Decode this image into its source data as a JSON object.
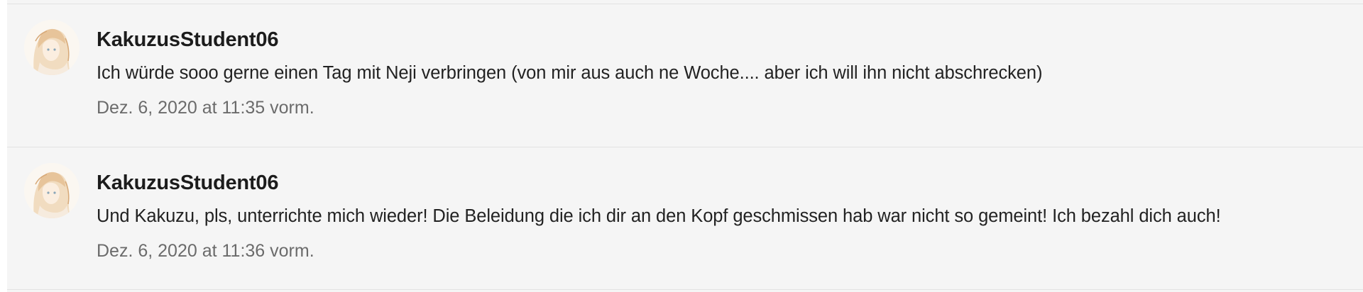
{
  "comments": [
    {
      "author": "KakuzusStudent06",
      "text": "Ich würde sooo gerne einen Tag mit Neji verbringen (von mir aus auch ne Woche.... aber ich will ihn nicht abschrecken)",
      "date": "Dez. 6, 2020 at 11:35 vorm.",
      "avatar_icon": "anime-character-avatar-icon"
    },
    {
      "author": "KakuzusStudent06",
      "text": "Und Kakuzu, pls, unterrichte mich wieder! Die Beleidung die ich dir an den Kopf geschmissen hab war nicht so gemeint! Ich bezahl dich auch!",
      "date": "Dez. 6, 2020 at 11:36 vorm.",
      "avatar_icon": "anime-character-avatar-icon"
    }
  ],
  "colors": {
    "background": "#f5f5f5",
    "divider": "#e2e2e2",
    "author": "#1c1c1c",
    "text": "#222222",
    "date": "#6b6b6b"
  }
}
